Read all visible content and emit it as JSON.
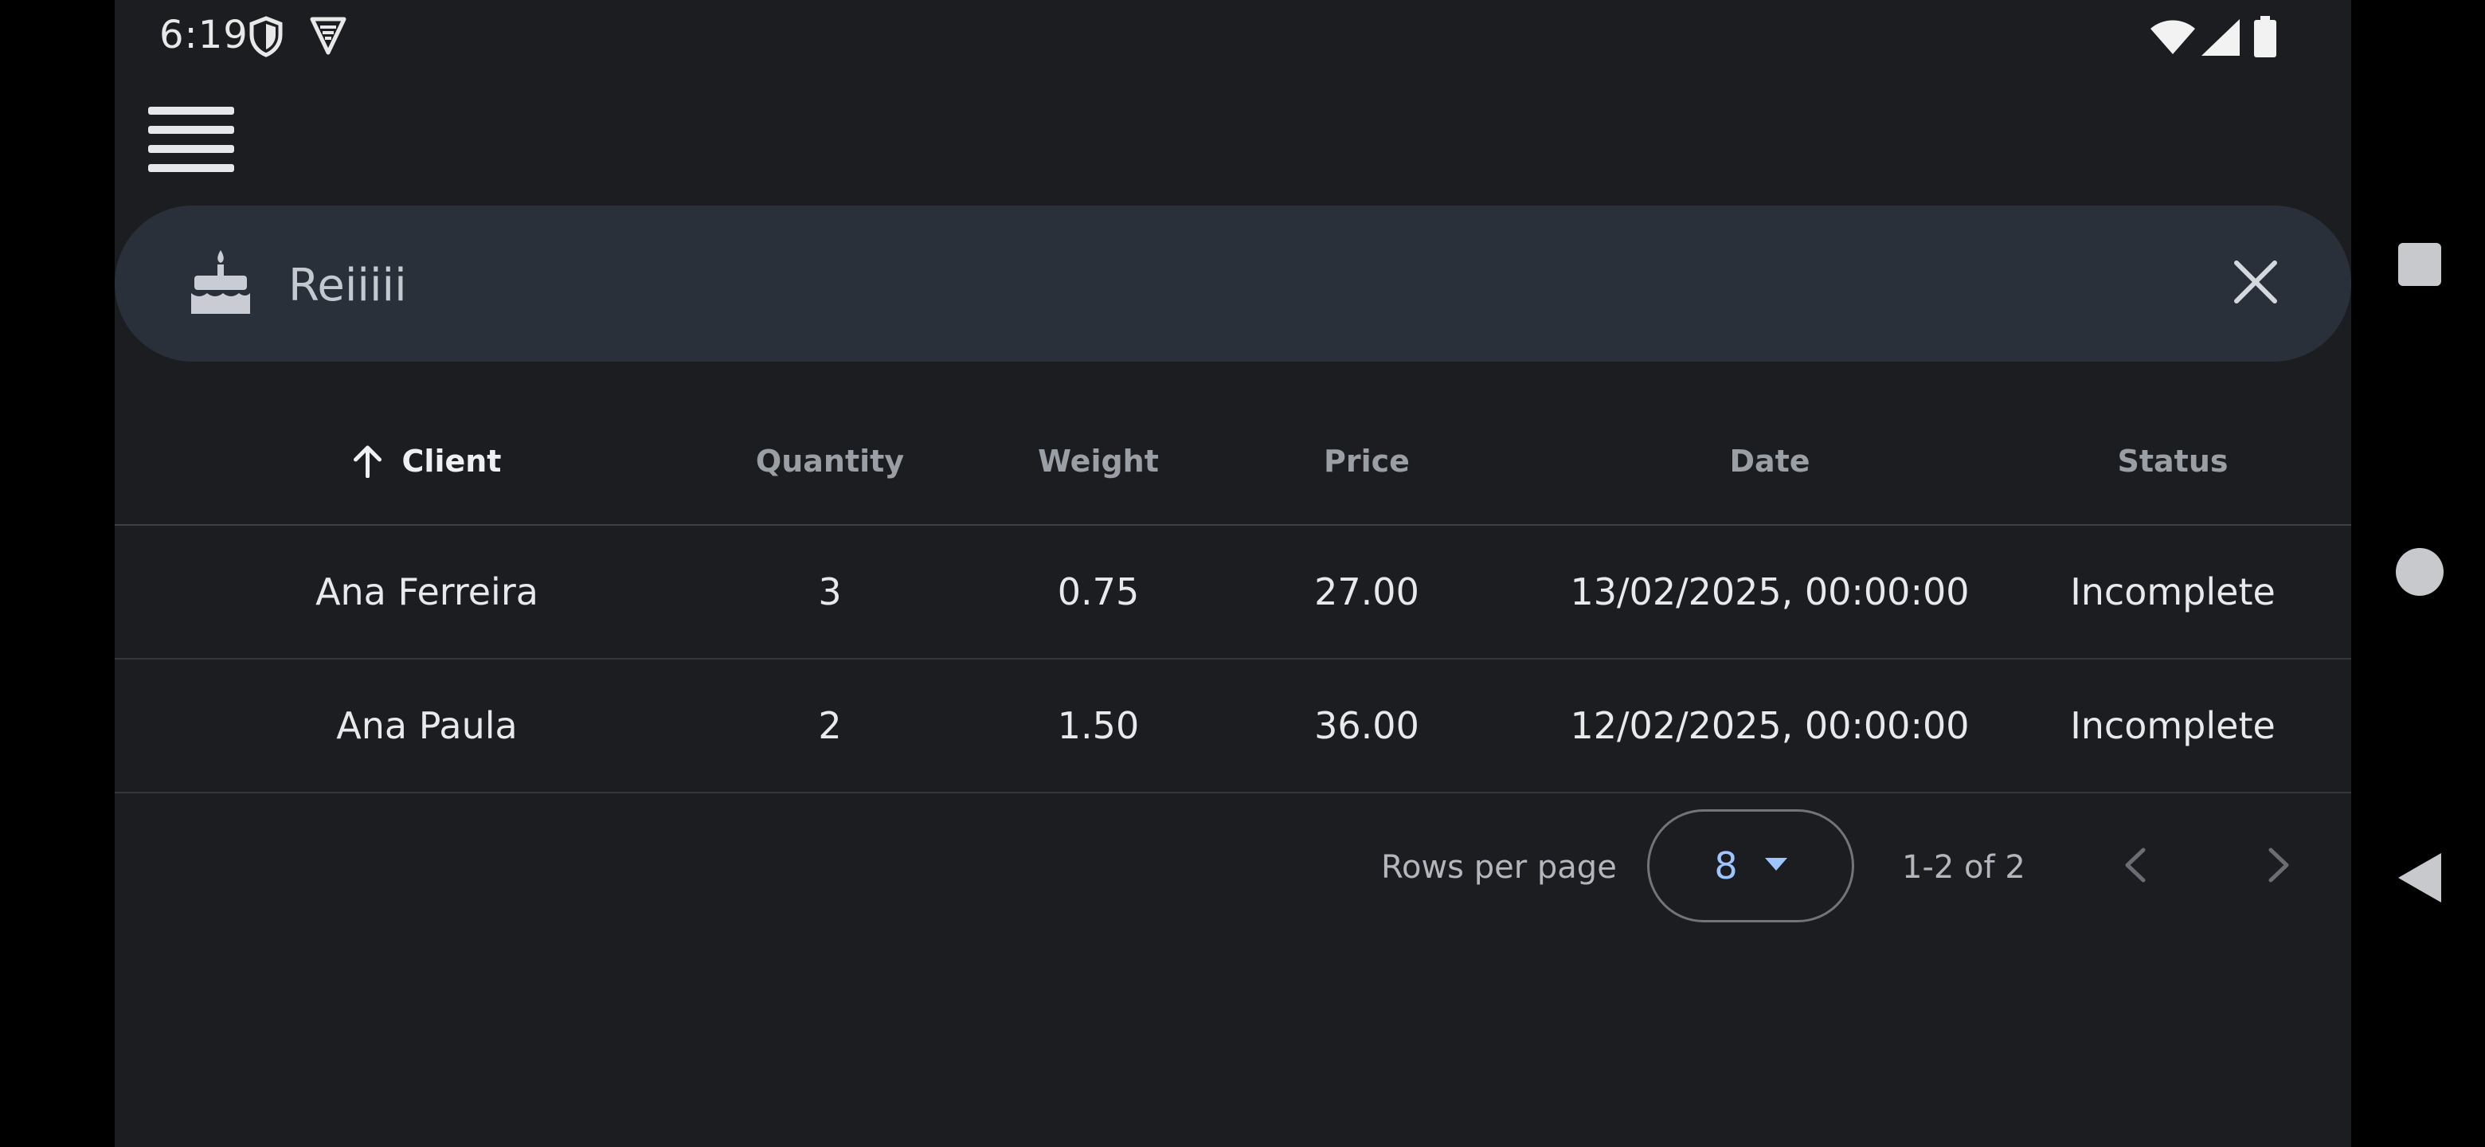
{
  "status_bar": {
    "time": "6:19",
    "icons": [
      "shield-icon",
      "vpn-badge-icon",
      "wifi-icon",
      "signal-icon",
      "battery-icon"
    ]
  },
  "toolbar": {
    "menu_icon": "menu-icon"
  },
  "search": {
    "value": "Reiiiii",
    "leading_icon": "cake-icon",
    "clear_icon": "close-icon"
  },
  "table": {
    "columns": [
      "Client",
      "Quantity",
      "Weight",
      "Price",
      "Date",
      "Status"
    ],
    "sorted_column": "Client",
    "sort_direction": "ascending",
    "rows": [
      {
        "client": "Ana Ferreira",
        "quantity": "3",
        "weight": "0.75",
        "price": "27.00",
        "date": "13/02/2025, 00:00:00",
        "status": "Incomplete"
      },
      {
        "client": "Ana Paula",
        "quantity": "2",
        "weight": "1.50",
        "price": "36.00",
        "date": "12/02/2025, 00:00:00",
        "status": "Incomplete"
      }
    ]
  },
  "pagination": {
    "rows_per_page_label": "Rows per page",
    "rows_per_page_value": "8",
    "range_text": "1-2 of 2"
  },
  "colors": {
    "background": "#1c1d20",
    "search_bar": "#29303a",
    "accent": "#9ec5ff",
    "text_muted": "#9a9ea5"
  },
  "nav_bar": {
    "icons": [
      "recents-square-icon",
      "home-circle-icon",
      "back-triangle-icon"
    ]
  }
}
